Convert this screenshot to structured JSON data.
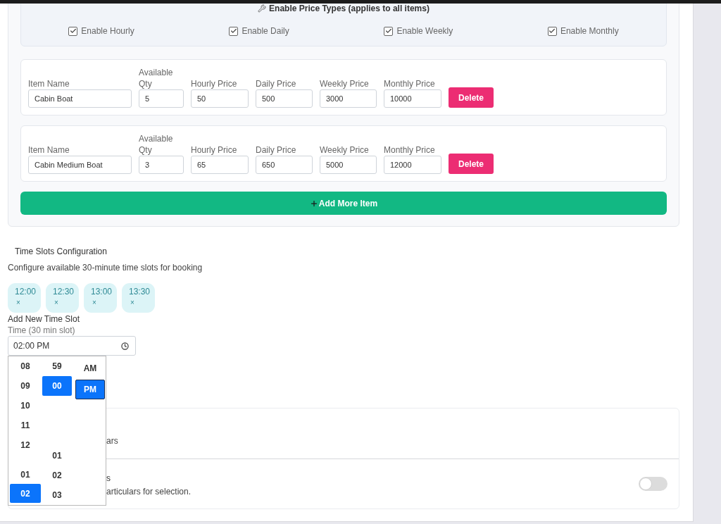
{
  "price_types": {
    "title": "Enable Price Types (applies to all items)",
    "options": [
      {
        "label": "Enable Hourly",
        "checked": true
      },
      {
        "label": "Enable Daily",
        "checked": true
      },
      {
        "label": "Enable Weekly",
        "checked": true
      },
      {
        "label": "Enable Monthly",
        "checked": true
      }
    ]
  },
  "items": [
    {
      "fields": [
        {
          "label": "Item Name",
          "value": "Cabin Boat"
        },
        {
          "label": "Available Qty",
          "value": "5"
        },
        {
          "label": "Hourly Price",
          "value": "50"
        },
        {
          "label": "Daily Price",
          "value": "500"
        },
        {
          "label": "Weekly Price",
          "value": "3000"
        },
        {
          "label": "Monthly Price",
          "value": "10000"
        }
      ],
      "delete_label": "Delete"
    },
    {
      "fields": [
        {
          "label": "Item Name",
          "value": "Cabin Medium Boat"
        },
        {
          "label": "Available Qty",
          "value": "3"
        },
        {
          "label": "Hourly Price",
          "value": "65"
        },
        {
          "label": "Daily Price",
          "value": "650"
        },
        {
          "label": "Weekly Price",
          "value": "5000"
        },
        {
          "label": "Monthly Price",
          "value": "12000"
        }
      ],
      "delete_label": "Delete"
    }
  ],
  "add_item_button": "Add More Item",
  "time_slots": {
    "heading": "Time Slots Configuration",
    "description": "Configure available 30-minute time slots for booking",
    "slots": [
      {
        "time": "12:00",
        "remove": "×"
      },
      {
        "time": "12:30",
        "remove": "×"
      },
      {
        "time": "13:00",
        "remove": "×"
      },
      {
        "time": "13:30",
        "remove": "×"
      }
    ]
  },
  "new_slot": {
    "heading": "Add New Time Slot",
    "label": "Time (30 min slot)",
    "value": "02:00 PM"
  },
  "time_picker": {
    "columns": [
      {
        "upper": [
          {
            "label": "08",
            "selected": false
          },
          {
            "label": "09",
            "selected": false
          },
          {
            "label": "10",
            "selected": false
          },
          {
            "label": "11",
            "selected": false
          },
          {
            "label": "12",
            "selected": false
          }
        ],
        "lower": [
          {
            "label": "01",
            "selected": false
          },
          {
            "label": "02",
            "selected": true
          }
        ]
      },
      {
        "upper": [
          {
            "label": "59",
            "selected": false
          },
          {
            "label": "00",
            "selected": true
          }
        ],
        "lower": [
          {
            "label": "01",
            "selected": false
          },
          {
            "label": "02",
            "selected": false
          },
          {
            "label": "03",
            "selected": false
          }
        ]
      },
      {
        "upper": [
          {
            "label": "AM",
            "selected": false
          },
          {
            "label": "PM",
            "selected": true
          }
        ]
      }
    ]
  },
  "settings": {
    "rows": [
      {
        "description": "ars"
      },
      {
        "title": "s",
        "description": "articulars for selection.",
        "toggle": {
          "on": false
        }
      }
    ]
  }
}
